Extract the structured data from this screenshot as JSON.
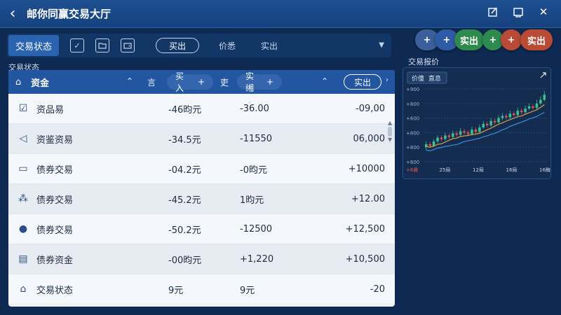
{
  "window": {
    "title": "邮你同赢交易大厅"
  },
  "toolbar": {
    "active_tab": "交易状态",
    "sell_pill": "买出",
    "price_tab": "价悉",
    "sell_tab": "实出"
  },
  "floating_buttons": [
    {
      "label": "+",
      "color": "#3b5f9b"
    },
    {
      "label": "+",
      "color": "#2f5ba6"
    },
    {
      "label": "实出",
      "color": "#2f8a4f"
    },
    {
      "label": "+",
      "color": "#2f8a4f"
    },
    {
      "label": "+",
      "color": "#b84a36"
    },
    {
      "label": "实出",
      "color": "#b84a36"
    }
  ],
  "labels": {
    "left_section": "交易状态",
    "right_section": "交易报价"
  },
  "table": {
    "header": {
      "title": "资金",
      "col1_text": "言",
      "buy_label": "买入",
      "buy_plus": "+",
      "col2_text": "吏",
      "sell_label": "实缃",
      "sell_plus": "+",
      "sell_button": "实出"
    },
    "rows": [
      {
        "icon": "edit-check-icon",
        "name": "资品易",
        "v1": "-46昀元",
        "v2": "-36.00",
        "v3": "-09,00"
      },
      {
        "icon": "speaker-icon",
        "name": "资鉴资易",
        "v1": "-34.5元",
        "v2": "-11550",
        "v3": "06,000"
      },
      {
        "icon": "video-icon",
        "name": "债券交易",
        "v1": "-04.2元",
        "v2": "-0昀元",
        "v3": "+10000"
      },
      {
        "icon": "people-icon",
        "name": "债券交易",
        "v1": "-45.2元",
        "v2": "1昀元",
        "v3": "+12.00"
      },
      {
        "icon": "user-icon",
        "name": "债券交易",
        "v1": "-50.2元",
        "v2": "-12500",
        "v3": "+12,500"
      },
      {
        "icon": "document-icon",
        "name": "债券资金",
        "v1": "-00昀元",
        "v2": "+1,220",
        "v3": "+10,500"
      },
      {
        "icon": "home-outline-icon",
        "name": "交易状态",
        "v1": "9元",
        "v2": "9元",
        "v3": "-20"
      }
    ]
  },
  "chart_card": {
    "tab1": "价僮",
    "tab2": "直息",
    "y_ticks": [
      "+900",
      "+800",
      "+600",
      "+800",
      "+800",
      "+600"
    ],
    "x_ticks": [
      "+6晨",
      "25局",
      "12局",
      "16局",
      "16酶"
    ],
    "colors": {
      "up": "#3fbf8f",
      "down": "#e2574c",
      "ma1": "#d9a441",
      "ma2": "#3d8fd0"
    }
  },
  "chart_data": {
    "type": "candlestick",
    "x_labels": [
      "+6晨",
      "25局",
      "12局",
      "16局",
      "16酶"
    ],
    "y_labels": [
      "+900",
      "+800",
      "+600",
      "+800",
      "+800",
      "+600"
    ],
    "trend": "rising",
    "candles": [
      {
        "o": 20,
        "c": 24,
        "h": 28,
        "l": 16
      },
      {
        "o": 24,
        "c": 22,
        "h": 27,
        "l": 19
      },
      {
        "o": 22,
        "c": 28,
        "h": 31,
        "l": 20
      },
      {
        "o": 28,
        "c": 33,
        "h": 36,
        "l": 25
      },
      {
        "o": 33,
        "c": 31,
        "h": 36,
        "l": 28
      },
      {
        "o": 31,
        "c": 36,
        "h": 40,
        "l": 29
      },
      {
        "o": 36,
        "c": 34,
        "h": 39,
        "l": 31
      },
      {
        "o": 34,
        "c": 39,
        "h": 43,
        "l": 32
      },
      {
        "o": 39,
        "c": 37,
        "h": 42,
        "l": 34
      },
      {
        "o": 37,
        "c": 42,
        "h": 46,
        "l": 35
      },
      {
        "o": 42,
        "c": 40,
        "h": 45,
        "l": 37
      },
      {
        "o": 40,
        "c": 38,
        "h": 43,
        "l": 35
      },
      {
        "o": 38,
        "c": 44,
        "h": 48,
        "l": 36
      },
      {
        "o": 44,
        "c": 41,
        "h": 47,
        "l": 39
      },
      {
        "o": 41,
        "c": 47,
        "h": 51,
        "l": 39
      },
      {
        "o": 47,
        "c": 52,
        "h": 56,
        "l": 45
      },
      {
        "o": 52,
        "c": 50,
        "h": 55,
        "l": 47
      },
      {
        "o": 50,
        "c": 56,
        "h": 60,
        "l": 48
      },
      {
        "o": 56,
        "c": 54,
        "h": 59,
        "l": 51
      },
      {
        "o": 54,
        "c": 60,
        "h": 64,
        "l": 52
      },
      {
        "o": 60,
        "c": 63,
        "h": 67,
        "l": 57
      },
      {
        "o": 63,
        "c": 61,
        "h": 66,
        "l": 58
      },
      {
        "o": 61,
        "c": 66,
        "h": 70,
        "l": 59
      },
      {
        "o": 66,
        "c": 64,
        "h": 69,
        "l": 62
      },
      {
        "o": 64,
        "c": 70,
        "h": 74,
        "l": 62
      },
      {
        "o": 70,
        "c": 68,
        "h": 73,
        "l": 65
      },
      {
        "o": 68,
        "c": 73,
        "h": 77,
        "l": 66
      },
      {
        "o": 73,
        "c": 76,
        "h": 80,
        "l": 71
      },
      {
        "o": 76,
        "c": 74,
        "h": 79,
        "l": 71
      },
      {
        "o": 74,
        "c": 80,
        "h": 85,
        "l": 72
      },
      {
        "o": 80,
        "c": 85,
        "h": 90,
        "l": 78
      },
      {
        "o": 85,
        "c": 92,
        "h": 97,
        "l": 83
      }
    ]
  }
}
